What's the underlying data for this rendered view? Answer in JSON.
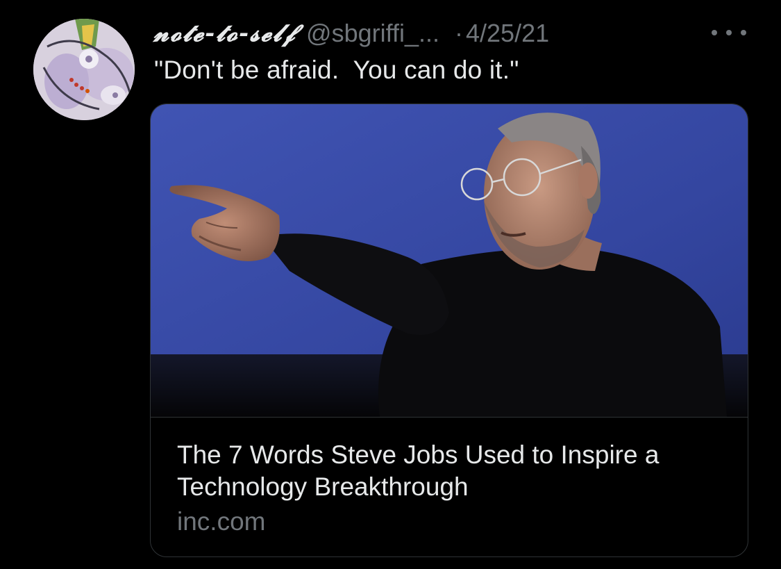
{
  "tweet": {
    "display_name": "𝓷𝓸𝓽𝓮-𝓽𝓸-𝓼𝓮𝓵𝓯",
    "handle": "@sbgriffi_...",
    "separator": "·",
    "date": "4/25/21",
    "text": "\"Don't be afraid.  You can do it.\"",
    "avatar_icon": "avatar-painting",
    "more_icon": "more-options-icon"
  },
  "card": {
    "title": "The 7 Words Steve Jobs Used to Inspire a Technology Breakthrough",
    "domain": "inc.com",
    "image_description_icon": "photo-man-pointing"
  },
  "colors": {
    "background": "#000000",
    "text_primary": "#e7e9ea",
    "text_secondary": "#71767b",
    "border": "#2f3336",
    "image_backdrop": "#3b4ea8"
  }
}
